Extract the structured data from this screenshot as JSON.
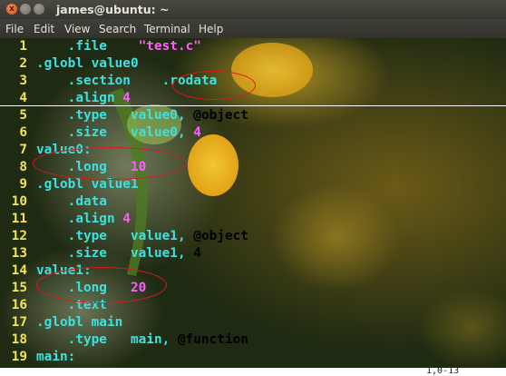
{
  "window": {
    "title": "james@ubuntu: ~",
    "buttons": {
      "close": "x",
      "minimize": "",
      "maximize": ""
    }
  },
  "menu": [
    "File",
    "Edit",
    "View",
    "Search",
    "Terminal",
    "Help"
  ],
  "editor": {
    "lines": [
      {
        "n": "1",
        "indent": "    ",
        "parts": [
          {
            "t": ".file",
            "c": "dir"
          },
          {
            "t": "    ",
            "c": "dir"
          },
          {
            "t": "\"test.c\"",
            "c": "str"
          }
        ]
      },
      {
        "n": "2",
        "indent": "",
        "parts": [
          {
            "t": ".globl",
            "c": "dir"
          },
          {
            "t": " value0",
            "c": "val"
          }
        ]
      },
      {
        "n": "3",
        "indent": "    ",
        "parts": [
          {
            "t": ".section",
            "c": "dir"
          },
          {
            "t": "    ",
            "c": "dir"
          },
          {
            "t": ".rodata",
            "c": "dir"
          }
        ]
      },
      {
        "n": "4",
        "indent": "    ",
        "parts": [
          {
            "t": ".align",
            "c": "dir"
          },
          {
            "t": " 4",
            "c": "num"
          }
        ]
      },
      {
        "n": "5",
        "indent": "    ",
        "parts": [
          {
            "t": ".type",
            "c": "dir"
          },
          {
            "t": "   value0, ",
            "c": "val"
          },
          {
            "t": "@object",
            "c": "white"
          }
        ]
      },
      {
        "n": "6",
        "indent": "    ",
        "parts": [
          {
            "t": ".size",
            "c": "dir"
          },
          {
            "t": "   value0, ",
            "c": "val"
          },
          {
            "t": "4",
            "c": "num"
          }
        ]
      },
      {
        "n": "7",
        "indent": "",
        "parts": [
          {
            "t": "value0:",
            "c": "lbl"
          }
        ]
      },
      {
        "n": "8",
        "indent": "    ",
        "parts": [
          {
            "t": ".long",
            "c": "dir"
          },
          {
            "t": "   ",
            "c": "dir"
          },
          {
            "t": "10",
            "c": "num"
          }
        ]
      },
      {
        "n": "9",
        "indent": "",
        "parts": [
          {
            "t": ".globl",
            "c": "dir"
          },
          {
            "t": " value1",
            "c": "val"
          }
        ]
      },
      {
        "n": "10",
        "indent": "    ",
        "parts": [
          {
            "t": ".data",
            "c": "dir"
          }
        ]
      },
      {
        "n": "11",
        "indent": "    ",
        "parts": [
          {
            "t": ".align",
            "c": "dir"
          },
          {
            "t": " 4",
            "c": "num"
          }
        ]
      },
      {
        "n": "12",
        "indent": "    ",
        "parts": [
          {
            "t": ".type",
            "c": "dir"
          },
          {
            "t": "   value1, ",
            "c": "val"
          },
          {
            "t": "@object",
            "c": "white"
          }
        ]
      },
      {
        "n": "13",
        "indent": "    ",
        "parts": [
          {
            "t": ".size",
            "c": "dir"
          },
          {
            "t": "   value1, ",
            "c": "val"
          },
          {
            "t": "4",
            "c": "white"
          }
        ]
      },
      {
        "n": "14",
        "indent": "",
        "parts": [
          {
            "t": "value1:",
            "c": "lbl"
          }
        ]
      },
      {
        "n": "15",
        "indent": "    ",
        "parts": [
          {
            "t": ".long",
            "c": "dir"
          },
          {
            "t": "   ",
            "c": "dir"
          },
          {
            "t": "20",
            "c": "num"
          }
        ]
      },
      {
        "n": "16",
        "indent": "    ",
        "parts": [
          {
            "t": ".text",
            "c": "dir"
          }
        ]
      },
      {
        "n": "17",
        "indent": "",
        "parts": [
          {
            "t": ".globl",
            "c": "dir"
          },
          {
            "t": " main",
            "c": "val"
          }
        ]
      },
      {
        "n": "18",
        "indent": "    ",
        "parts": [
          {
            "t": ".type",
            "c": "dir"
          },
          {
            "t": "   main, ",
            "c": "val"
          },
          {
            "t": "@function",
            "c": "white"
          }
        ]
      },
      {
        "n": "19",
        "indent": "",
        "parts": [
          {
            "t": "main:",
            "c": "lbl"
          }
        ]
      }
    ],
    "status_left": "",
    "status_right": "1,0-13"
  },
  "colors": {
    "line_number": "#f3e35a",
    "directive": "#3fe0e0",
    "literal": "#ff5cff",
    "annotation": "#e0181a"
  }
}
